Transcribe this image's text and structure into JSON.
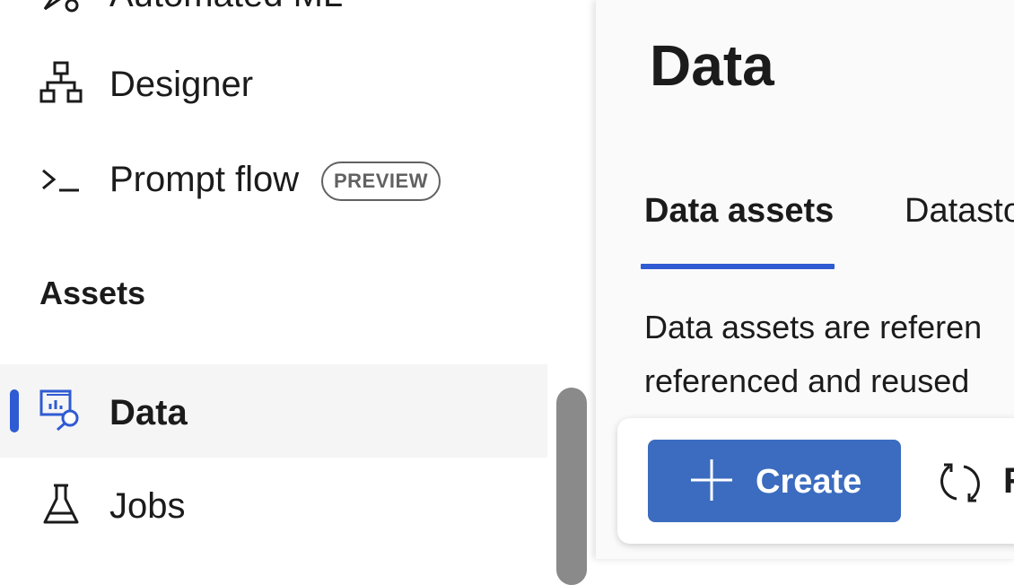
{
  "sidebar": {
    "items": [
      {
        "label": "Automated ML",
        "icon": "automated-ml-icon"
      },
      {
        "label": "Designer",
        "icon": "designer-icon"
      },
      {
        "label": "Prompt flow",
        "icon": "prompt-flow-icon",
        "badge": "PREVIEW"
      },
      {
        "label": "Data",
        "icon": "data-icon",
        "active": true
      },
      {
        "label": "Jobs",
        "icon": "jobs-icon"
      }
    ],
    "section_assets": "Assets"
  },
  "main": {
    "title": "Data",
    "tabs": [
      {
        "label": "Data assets",
        "active": true
      },
      {
        "label": "Datasto"
      }
    ],
    "description": [
      "Data assets are referen",
      "referenced and reused"
    ],
    "toolbar": {
      "create_label": "Create",
      "refresh_label": "R"
    }
  },
  "colors": {
    "accent": "#2f5bd3",
    "button_bg": "#3b6cbf",
    "active_item_bg": "#f5f5f5",
    "badge_border": "#616161"
  }
}
